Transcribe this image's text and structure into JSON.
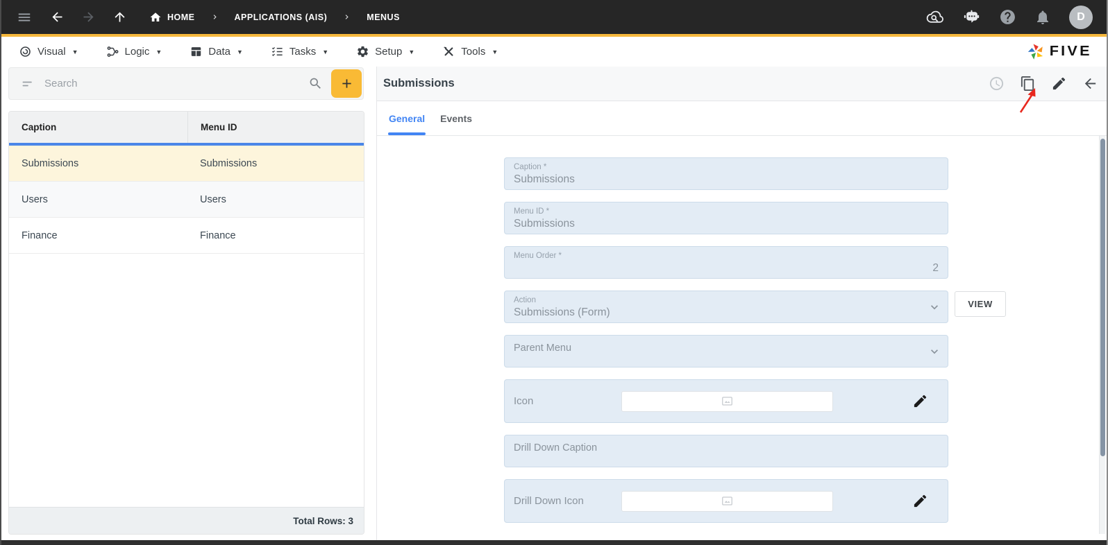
{
  "topbar": {
    "breadcrumbs": [
      "HOME",
      "APPLICATIONS (AIS)",
      "MENUS"
    ],
    "avatar_initial": "D"
  },
  "menubar": {
    "items": [
      "Visual",
      "Logic",
      "Data",
      "Tasks",
      "Setup",
      "Tools"
    ],
    "brand": "FIVE"
  },
  "left_panel": {
    "search": {
      "placeholder": "Search"
    },
    "table": {
      "columns": [
        "Caption",
        "Menu ID"
      ],
      "rows": [
        [
          "Submissions",
          "Submissions"
        ],
        [
          "Users",
          "Users"
        ],
        [
          "Finance",
          "Finance"
        ]
      ],
      "selected_row": "Submissions",
      "footer_label": "Total Rows: 3"
    }
  },
  "detail_panel": {
    "title": "Submissions",
    "tabs": [
      "General",
      "Events"
    ],
    "active_tab": "General",
    "view_button_label": "VIEW",
    "fields": {
      "caption": {
        "label": "Caption *",
        "value": "Submissions"
      },
      "menu_id": {
        "label": "Menu ID *",
        "value": "Submissions"
      },
      "menu_order": {
        "label": "Menu Order *",
        "value": "2"
      },
      "action": {
        "label": "Action",
        "value": "Submissions (Form)"
      },
      "parent_menu": {
        "label": "Parent Menu",
        "value": ""
      },
      "icon": {
        "label": "Icon",
        "value": ""
      },
      "drill_down_caption": {
        "label": "Drill Down Caption",
        "value": ""
      },
      "drill_down_icon": {
        "label": "Drill Down Icon",
        "value": ""
      }
    }
  },
  "colors": {
    "topbar_bg": "#262626",
    "accent_yellow": "#F6B83C",
    "accent_blue": "#4285F4",
    "selected_row_bg": "#FDF5DC",
    "field_bg": "#E3ECF5"
  }
}
